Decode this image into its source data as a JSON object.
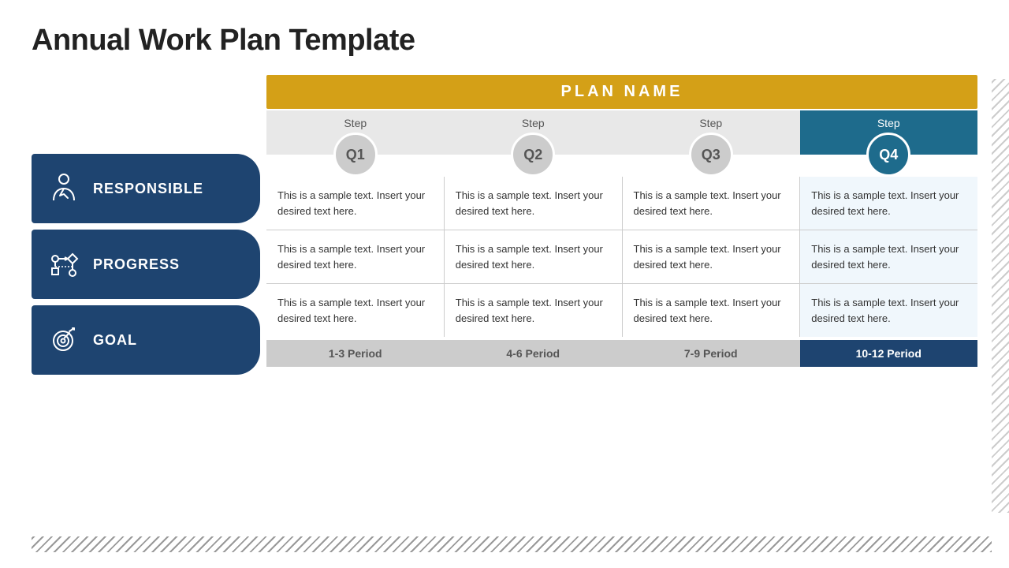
{
  "title": "Annual Work Plan Template",
  "plan_header": "PLAN NAME",
  "steps": [
    {
      "label": "Step",
      "q": "Q1",
      "active": false
    },
    {
      "label": "Step",
      "q": "Q2",
      "active": false
    },
    {
      "label": "Step",
      "q": "Q3",
      "active": false
    },
    {
      "label": "Step",
      "q": "Q4",
      "active": true
    }
  ],
  "periods": [
    {
      "label": "1-3 Period",
      "active": false
    },
    {
      "label": "4-6 Period",
      "active": false
    },
    {
      "label": "7-9 Period",
      "active": false
    },
    {
      "label": "10-12 Period",
      "active": true
    }
  ],
  "sidebar": [
    {
      "id": "responsible",
      "label": "RESPONSIBLE",
      "icon": "person"
    },
    {
      "id": "progress",
      "label": "PROGRESS",
      "icon": "arrows"
    },
    {
      "id": "goal",
      "label": "GOAL",
      "icon": "target"
    }
  ],
  "sample_text": "This is a sample text. Insert your desired text here.",
  "rows": [
    {
      "cells": [
        "This is a sample text. Insert your desired text here.",
        "This is a sample text. Insert your desired text here.",
        "This is a sample text. Insert your desired text here.",
        "This is a sample text. Insert your desired text here."
      ]
    },
    {
      "cells": [
        "This is a sample text. Insert your desired text here.",
        "This is a sample text. Insert your desired text here.",
        "This is a sample text. Insert your desired text here.",
        "This is a sample text. Insert your desired text here."
      ]
    },
    {
      "cells": [
        "This is a sample text. Insert your desired text here.",
        "This is a sample text. Insert your desired text here.",
        "This is a sample text. Insert your desired text here.",
        "This is a sample text. Insert your desired text here."
      ]
    }
  ]
}
